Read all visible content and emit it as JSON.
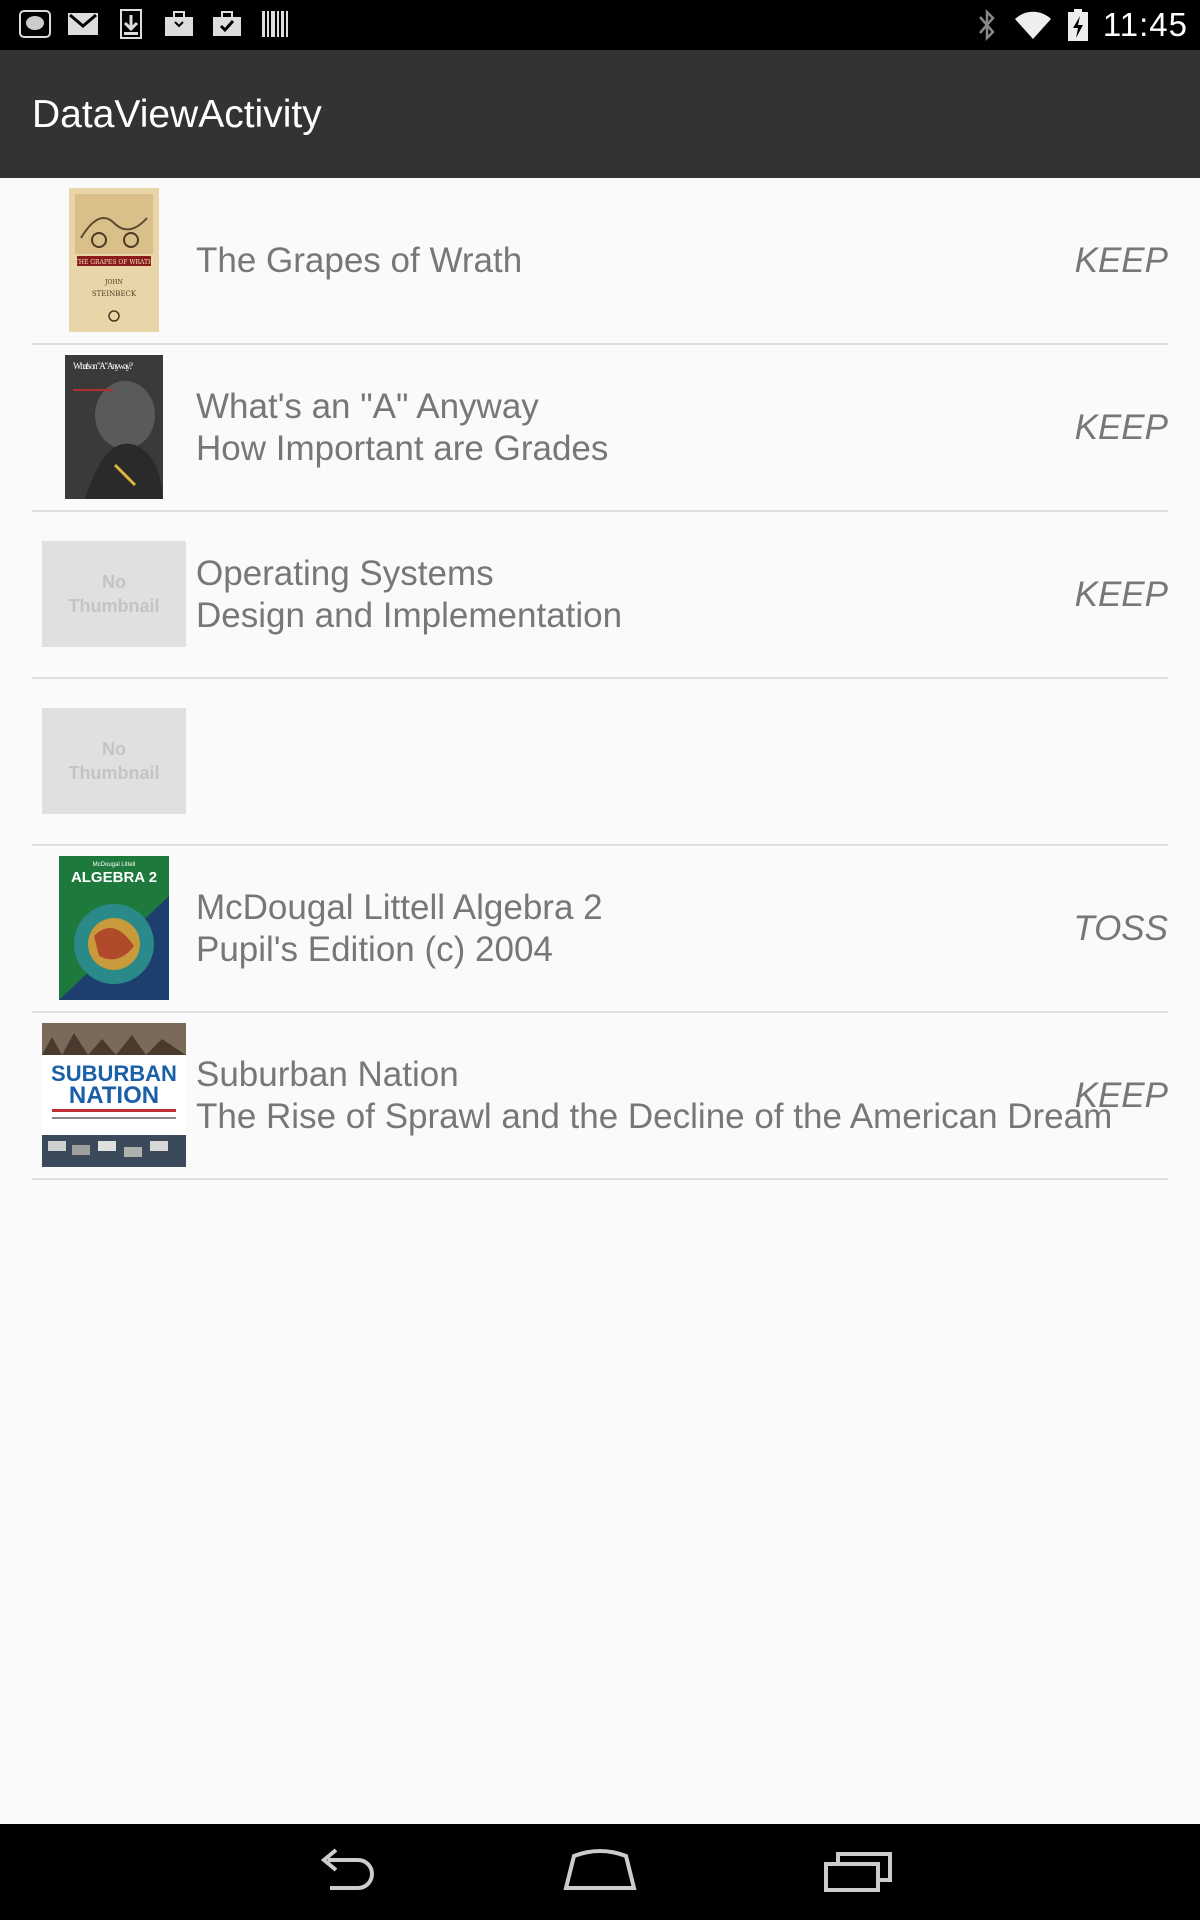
{
  "status_bar": {
    "time": "11:45",
    "left_icons": [
      "app-icon",
      "gmail-icon",
      "download-icon",
      "briefcase-icon",
      "briefcase-check-icon",
      "barcode-icon"
    ],
    "right_icons": [
      "bluetooth-icon",
      "wifi-icon",
      "battery-charging-icon"
    ]
  },
  "app_bar": {
    "title": "DataViewActivity"
  },
  "no_thumbnail": {
    "line1": "No",
    "line2": "Thumbnail"
  },
  "items": [
    {
      "line1": "The Grapes of Wrath",
      "line2": "",
      "status": "KEEP",
      "thumbnail": "grapes-of-wrath-cover"
    },
    {
      "line1": "What's an \"A\" Anyway",
      "line2": "How Important are Grades",
      "status": "KEEP",
      "thumbnail": "whats-an-a-cover"
    },
    {
      "line1": "Operating Systems",
      "line2": "Design and Implementation",
      "status": "KEEP",
      "thumbnail": "none"
    },
    {
      "line1": "",
      "line2": "",
      "status": "",
      "thumbnail": "none"
    },
    {
      "line1": "McDougal Littell Algebra 2",
      "line2": "Pupil's Edition (c) 2004",
      "status": "TOSS",
      "thumbnail": "algebra-2-cover"
    },
    {
      "line1": "Suburban Nation",
      "line2": "The Rise of Sprawl and the Decline of the American Dream",
      "status": "KEEP",
      "thumbnail": "suburban-nation-cover"
    }
  ],
  "cover_text": {
    "grapes": {
      "title": "THE GRAPES OF WRATH",
      "author": "JOHN",
      "author2": "STEINBECK"
    },
    "whats_a": {
      "title": "What's on \"A\" Anyway?"
    },
    "algebra": {
      "publisher": "McDougal Littell",
      "title": "ALGEBRA 2"
    },
    "suburban": {
      "line1": "SUBURBAN",
      "line2": "NATION"
    }
  },
  "nav_bar": {
    "buttons": [
      "back-icon",
      "home-icon",
      "recents-icon"
    ]
  }
}
